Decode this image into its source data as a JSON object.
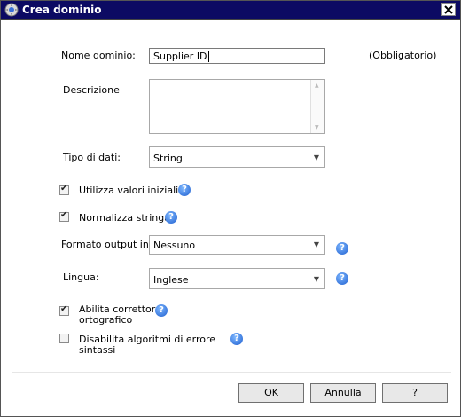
{
  "window": {
    "title": "Crea dominio"
  },
  "form": {
    "domain_name": {
      "label": "Nome dominio:",
      "value": "Supplier ID",
      "required_note": "(Obbligatorio)"
    },
    "description": {
      "label": "Descrizione",
      "value": ""
    },
    "data_type": {
      "label": "Tipo di dati:",
      "value": "String"
    },
    "use_leading_values": {
      "label": "Utilizza valori iniziali",
      "checked": true
    },
    "normalize_string": {
      "label": "Normalizza stringa",
      "checked": true
    },
    "output_format": {
      "label": "Formato output in:",
      "value": "Nessuno"
    },
    "language": {
      "label": "Lingua:",
      "value": "Inglese"
    },
    "enable_speller": {
      "label_line1": "Abilita correttore",
      "label_line2": "ortografico",
      "checked": true
    },
    "disable_syntax": {
      "label_line1": "Disabilita algoritmi di errore",
      "label_line2": "sintassi",
      "checked": false
    }
  },
  "buttons": {
    "ok": "OK",
    "cancel": "Annulla",
    "help": "?"
  },
  "icons": {
    "help": "help-icon",
    "close": "close-icon",
    "app": "app-icon"
  }
}
